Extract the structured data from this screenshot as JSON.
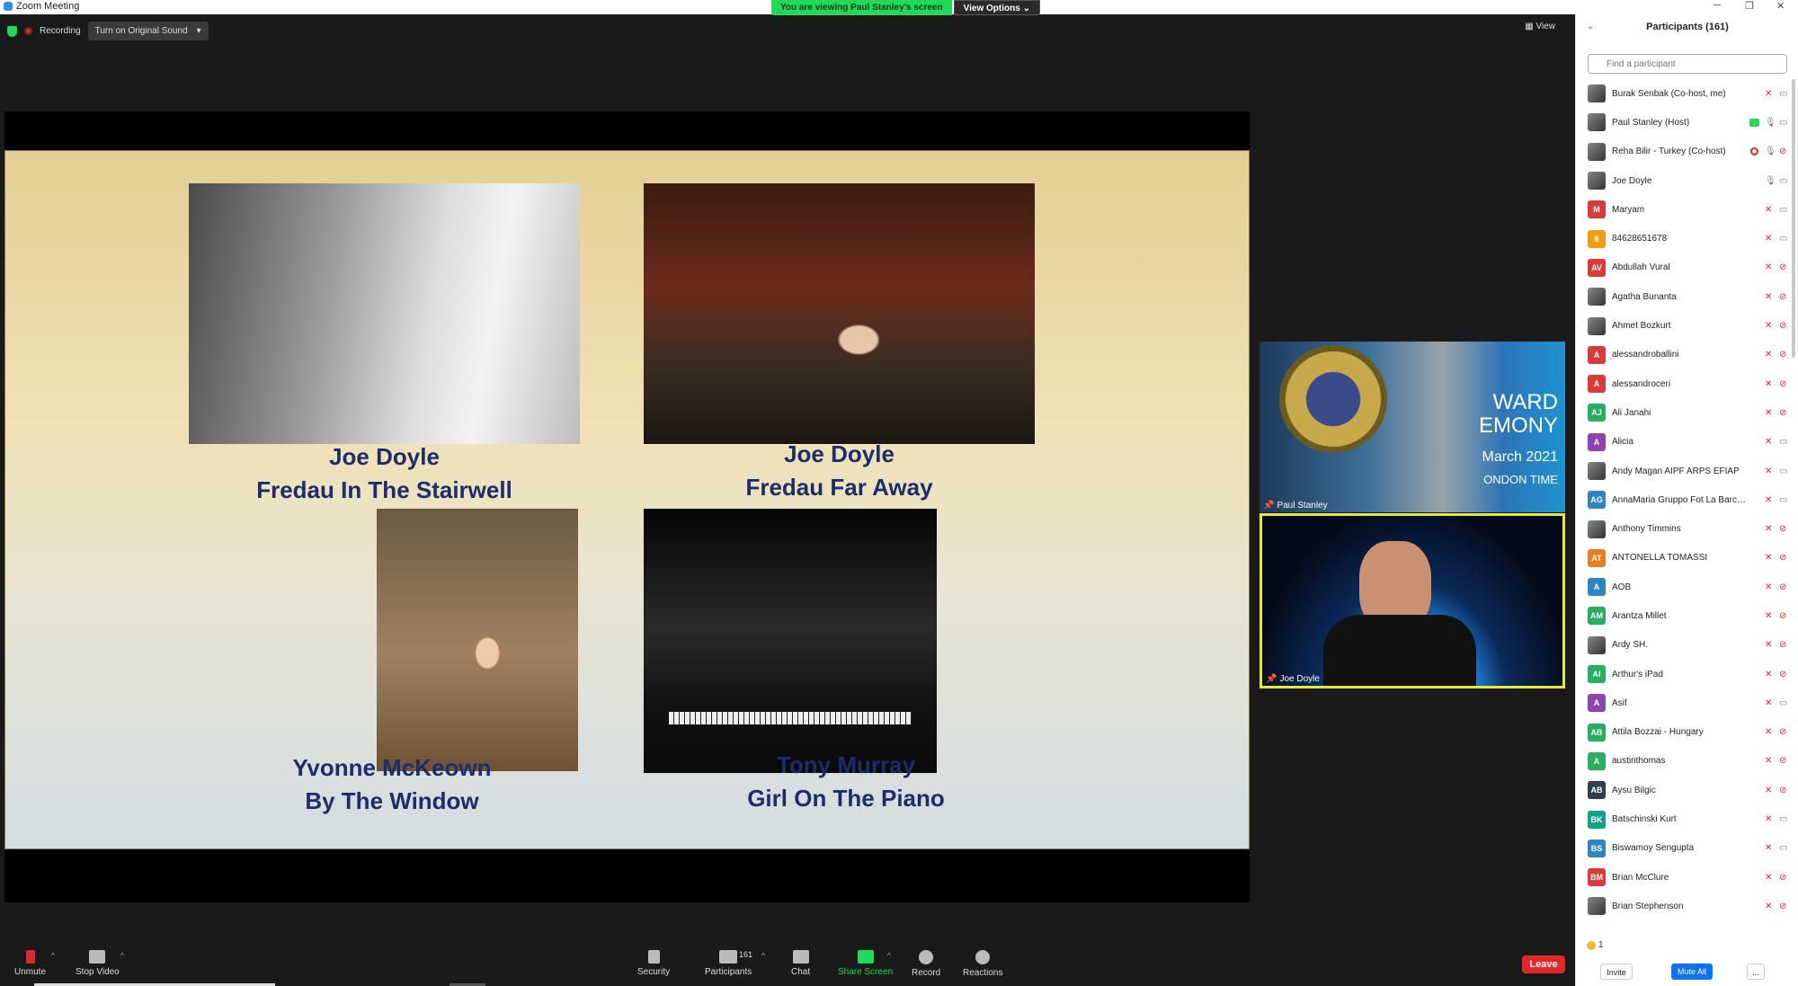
{
  "window": {
    "title": "Zoom Meeting"
  },
  "banner": {
    "viewing": "You are viewing Paul Stanley's screen",
    "view_options": "View Options"
  },
  "topbar": {
    "recording": "Recording",
    "original_sound": "Turn on Original Sound",
    "view": "View"
  },
  "slide": {
    "captions": [
      {
        "name": "Joe Doyle",
        "title": "Fredau In The Stairwell"
      },
      {
        "name": "Joe Doyle",
        "title": "Fredau Far Away"
      },
      {
        "name": "Yvonne McKeown",
        "title": "By The Window"
      },
      {
        "name": "Tony Murray",
        "title": "Girl On The Piano"
      }
    ]
  },
  "videos": {
    "tile1": {
      "name": "Paul Stanley",
      "background_lines": [
        "WARD",
        "EMONY",
        "March 2021",
        "ONDON TIME"
      ]
    },
    "tile2": {
      "name": "Joe Doyle"
    }
  },
  "toolbar": {
    "unmute": "Unmute",
    "stop_video": "Stop Video",
    "security": "Security",
    "participants": "Participants",
    "participant_count": "161",
    "chat": "Chat",
    "share_screen": "Share Screen",
    "record": "Record",
    "reactions": "Reactions",
    "leave": "Leave"
  },
  "panel": {
    "title": "Participants (161)",
    "search_placeholder": "Find a participant",
    "clap_count": "1",
    "invite": "Invite",
    "mute_all": "Mute All",
    "more": "..."
  },
  "participants": [
    {
      "name": "Burak Senbak (Co-host, me)",
      "initials": "",
      "color": "",
      "photo": true,
      "mic": "muted",
      "cam": "on"
    },
    {
      "name": "Paul Stanley (Host)",
      "initials": "",
      "color": "",
      "photo": true,
      "mic": "on",
      "cam": "on",
      "sharing": true
    },
    {
      "name": "Reha Bilir - Turkey (Co-host)",
      "initials": "",
      "color": "",
      "photo": true,
      "mic": "on",
      "cam": "off",
      "recording": true
    },
    {
      "name": "Joe Doyle",
      "initials": "",
      "color": "",
      "photo": true,
      "mic": "on",
      "cam": "on"
    },
    {
      "name": "Maryam",
      "initials": "M",
      "color": "#d93b3b",
      "mic": "muted",
      "cam": "on"
    },
    {
      "name": "84628651678",
      "initials": "8",
      "color": "#f39c12",
      "mic": "muted",
      "cam": "on"
    },
    {
      "name": "Abdullah Vural",
      "initials": "AV",
      "color": "#d93b3b",
      "mic": "muted",
      "cam": "off"
    },
    {
      "name": "Agatha Bunanta",
      "initials": "",
      "color": "",
      "photo": true,
      "mic": "muted",
      "cam": "off"
    },
    {
      "name": "Ahmet Bozkurt",
      "initials": "",
      "color": "",
      "photo": true,
      "mic": "muted",
      "cam": "off"
    },
    {
      "name": "alessandroballini",
      "initials": "A",
      "color": "#d93b3b",
      "mic": "muted",
      "cam": "off"
    },
    {
      "name": "alessandroceri",
      "initials": "A",
      "color": "#d93b3b",
      "mic": "muted",
      "cam": "off"
    },
    {
      "name": "Ali Janahi",
      "initials": "AJ",
      "color": "#27ae60",
      "mic": "muted",
      "cam": "off"
    },
    {
      "name": "Alicia",
      "initials": "A",
      "color": "#8e44ad",
      "mic": "muted",
      "cam": "on"
    },
    {
      "name": "Andy Magan AIPF ARPS EFIAP",
      "initials": "",
      "color": "",
      "photo": true,
      "mic": "muted",
      "cam": "on"
    },
    {
      "name": "AnnaMaria Gruppo Fot La Barch...",
      "initials": "AG",
      "color": "#2e86c1",
      "mic": "muted",
      "cam": "on"
    },
    {
      "name": "Anthony Timmins",
      "initials": "",
      "color": "",
      "photo": true,
      "mic": "muted",
      "cam": "off"
    },
    {
      "name": "ANTONELLA TOMASSI",
      "initials": "AT",
      "color": "#e67e22",
      "mic": "muted",
      "cam": "off"
    },
    {
      "name": "AOB",
      "initials": "A",
      "color": "#2e86c1",
      "mic": "muted",
      "cam": "off"
    },
    {
      "name": "Arantza Millet",
      "initials": "AM",
      "color": "#27ae60",
      "mic": "muted",
      "cam": "off"
    },
    {
      "name": "Ardy SH.",
      "initials": "",
      "color": "",
      "photo": true,
      "mic": "muted",
      "cam": "off"
    },
    {
      "name": "Arthur's iPad",
      "initials": "AI",
      "color": "#27ae60",
      "mic": "muted",
      "cam": "off"
    },
    {
      "name": "Asif",
      "initials": "A",
      "color": "#8e44ad",
      "mic": "muted",
      "cam": "on"
    },
    {
      "name": "Attila Bozzai - Hungary",
      "initials": "AB",
      "color": "#27ae60",
      "mic": "muted",
      "cam": "off"
    },
    {
      "name": "austinthomas",
      "initials": "A",
      "color": "#27ae60",
      "mic": "muted",
      "cam": "off"
    },
    {
      "name": "Aysu Bilgic",
      "initials": "AB",
      "color": "#2c3e50",
      "mic": "muted",
      "cam": "off"
    },
    {
      "name": "Batschinski Kurt",
      "initials": "BK",
      "color": "#16a085",
      "mic": "muted",
      "cam": "on"
    },
    {
      "name": "Biswamoy Sengupta",
      "initials": "BS",
      "color": "#2e86c1",
      "mic": "muted",
      "cam": "on"
    },
    {
      "name": "Brian McClure",
      "initials": "BM",
      "color": "#d93b3b",
      "mic": "muted",
      "cam": "off"
    },
    {
      "name": "Brian Stephenson",
      "initials": "",
      "color": "",
      "photo": true,
      "mic": "muted",
      "cam": "off"
    }
  ]
}
